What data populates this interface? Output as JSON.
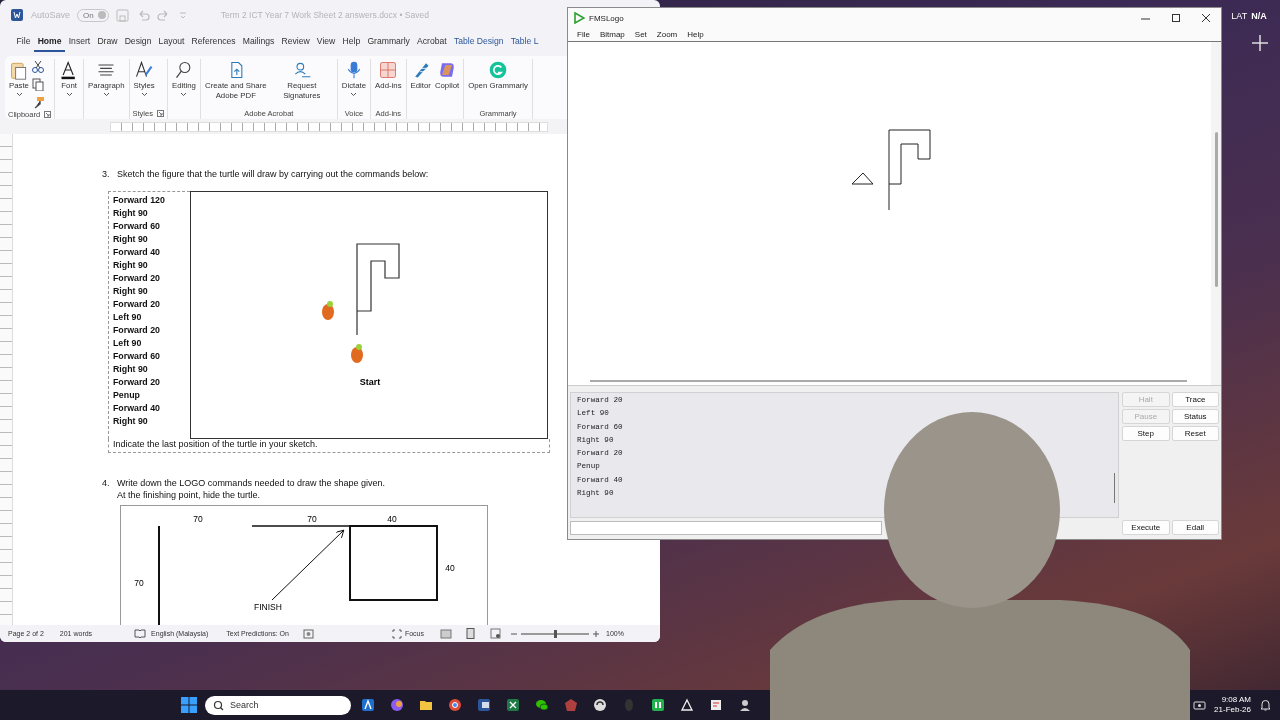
{
  "word_window": {
    "title_bar": {
      "autosave_label": "AutoSave",
      "autosave_toggle": "On",
      "document_title": "Term 2 ICT Year 7 Work Sheet 2 answers.docx • Saved"
    },
    "tabs": [
      {
        "label": "File",
        "selected": false,
        "kind": "normal"
      },
      {
        "label": "Home",
        "selected": true,
        "kind": "normal"
      },
      {
        "label": "Insert",
        "selected": false,
        "kind": "normal"
      },
      {
        "label": "Draw",
        "selected": false,
        "kind": "normal"
      },
      {
        "label": "Design",
        "selected": false,
        "kind": "normal"
      },
      {
        "label": "Layout",
        "selected": false,
        "kind": "normal"
      },
      {
        "label": "References",
        "selected": false,
        "kind": "normal"
      },
      {
        "label": "Mailings",
        "selected": false,
        "kind": "normal"
      },
      {
        "label": "Review",
        "selected": false,
        "kind": "normal"
      },
      {
        "label": "View",
        "selected": false,
        "kind": "normal"
      },
      {
        "label": "Help",
        "selected": false,
        "kind": "normal"
      },
      {
        "label": "Grammarly",
        "selected": false,
        "kind": "normal"
      },
      {
        "label": "Acrobat",
        "selected": false,
        "kind": "normal"
      },
      {
        "label": "Table Design",
        "selected": false,
        "kind": "contextual"
      },
      {
        "label": "Table L",
        "selected": false,
        "kind": "contextual"
      }
    ],
    "ribbon_groups": [
      {
        "label": "Clipboard",
        "buttons": [
          "Paste"
        ]
      },
      {
        "buttons": [
          "Font"
        ]
      },
      {
        "buttons": [
          "Paragraph"
        ]
      },
      {
        "label": "Styles",
        "buttons": [
          "Styles"
        ]
      },
      {
        "buttons": [
          "Editing"
        ]
      },
      {
        "label": "Adobe Acrobat",
        "buttons": [
          "Create and Share Adobe PDF",
          "Request Signatures"
        ]
      },
      {
        "label": "Voice",
        "buttons": [
          "Dictate"
        ]
      },
      {
        "label": "Add-ins",
        "buttons": [
          "Add-ins"
        ]
      },
      {
        "buttons": [
          "Editor",
          "Copilot"
        ]
      },
      {
        "label": "Grammarly",
        "buttons": [
          "Open Grammarly"
        ]
      }
    ],
    "document": {
      "question_3": {
        "number": "3.",
        "prompt": "Sketch the figure that the turtle will draw by carrying out the commands below:",
        "commands": [
          "Forward 120",
          "Right 90",
          "Forward 60",
          "Right 90",
          "Forward 40",
          "Right 90",
          "Forward 20",
          "Right 90",
          "Forward 20",
          "Left 90",
          "Forward 20",
          "Left 90",
          "Forward 60",
          "Right 90",
          "Forward 20",
          "Penup",
          "Forward 40",
          "Right 90"
        ],
        "start_label": "Start",
        "note": "Indicate the last position of the turtle in your sketch."
      },
      "question_4": {
        "number": "4.",
        "lines": [
          "Write down the LOGO commands needed to draw the shape given.",
          "At the finishing point, hide the turtle."
        ],
        "figure_labels": [
          "70",
          "70",
          "40",
          "40",
          "70",
          "FINISH"
        ]
      }
    },
    "status_bar": {
      "page": "Page 2 of 2",
      "words": "201 words",
      "language": "English (Malaysia)",
      "text_predictions": "Text Predictions: On",
      "focus": "Focus",
      "zoom": "100%",
      "zoom_slider": {
        "level": 0.5
      }
    }
  },
  "logo_window": {
    "title": "FMSLogo",
    "menu": [
      "File",
      "Bitmap",
      "Set",
      "Zoom",
      "Help"
    ],
    "history": [
      "Forward 20",
      "Left 90",
      "Forward 60",
      "Right 90",
      "Forward 20",
      "Penup",
      "Forward 40",
      "Right 90"
    ],
    "side_buttons": [
      {
        "label": "Halt",
        "disabled": true
      },
      {
        "label": "Trace",
        "disabled": false
      },
      {
        "label": "Pause",
        "disabled": true
      },
      {
        "label": "Status",
        "disabled": false
      },
      {
        "label": "Step",
        "disabled": false
      },
      {
        "label": "Reset",
        "disabled": false
      }
    ],
    "execute_label": "Execute",
    "edall_label": "Edall"
  },
  "desktop": {
    "language_code": "LAT",
    "layout": "N/A"
  },
  "taskbar": {
    "search_placeholder": "Search",
    "time": "9:08 AM",
    "date": "21-Feb-26"
  }
}
